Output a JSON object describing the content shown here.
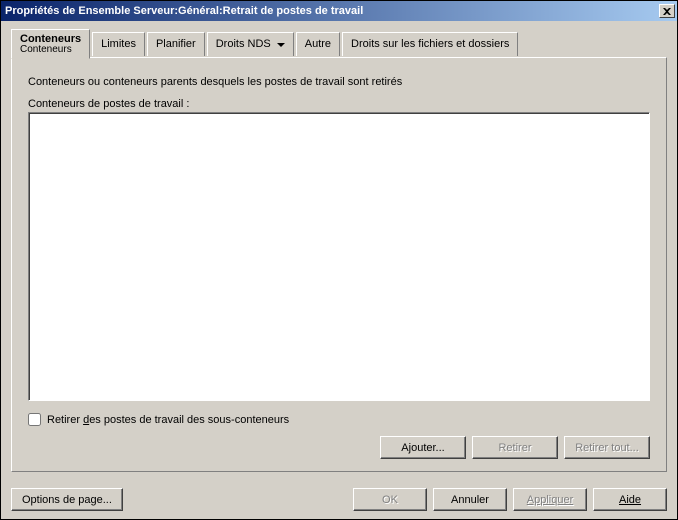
{
  "window": {
    "title": "Propriétés de Ensemble Serveur:Général:Retrait de postes de travail"
  },
  "tabs": {
    "conteneurs": {
      "label": "Conteneurs",
      "sub": "Conteneurs"
    },
    "limites": {
      "label": "Limites"
    },
    "planifier": {
      "label": "Planifier"
    },
    "droits_nds": {
      "label": "Droits NDS"
    },
    "autre": {
      "label": "Autre"
    },
    "droits_fichiers": {
      "label": "Droits sur les fichiers et dossiers"
    }
  },
  "panel": {
    "description": "Conteneurs ou conteneurs parents desquels les postes de travail sont retirés",
    "list_label": "Conteneurs de postes de travail :",
    "checkbox_text_pre": "Retirer ",
    "checkbox_text_u": "d",
    "checkbox_text_post": "es postes de travail des sous-conteneurs",
    "checkbox_checked": false,
    "btn": {
      "ajouter_pre": "A",
      "ajouter_u": "j",
      "ajouter_post": "outer...",
      "retirer": "Retirer",
      "retirer_tout": "Retirer tout..."
    }
  },
  "bottom": {
    "options": "Options de page...",
    "ok": "OK",
    "annuler": "Annuler",
    "appliquer": "Appliquer",
    "aide": "Aide"
  }
}
